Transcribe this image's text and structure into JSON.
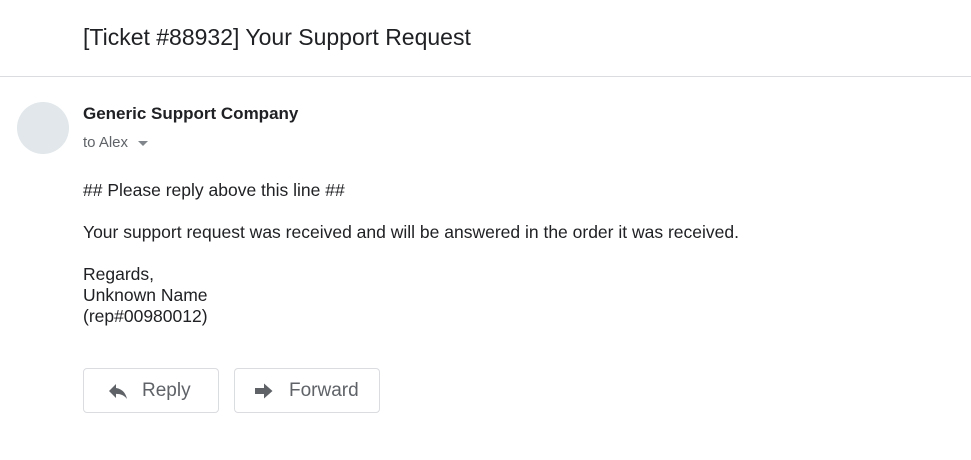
{
  "email": {
    "subject": "[Ticket #88932] Your Support Request",
    "sender": "Generic Support Company",
    "recipient_label": "to Alex",
    "body": {
      "line1": "## Please reply above this line ##",
      "line2": "Your support request was received and will be answered in the order it was received.",
      "signature": [
        "Regards,",
        "Unknown Name",
        "(rep#00980012)"
      ]
    }
  },
  "actions": {
    "reply_label": "Reply",
    "forward_label": "Forward"
  },
  "icons": {
    "avatar": "avatar-placeholder",
    "recipient_details": "chevron-down-icon",
    "reply": "reply-arrow-icon",
    "forward": "forward-arrow-icon"
  },
  "colors": {
    "text_primary": "#202124",
    "text_secondary": "#5f6368",
    "divider": "#dadce0",
    "avatar_bg": "#e1e7ea"
  }
}
